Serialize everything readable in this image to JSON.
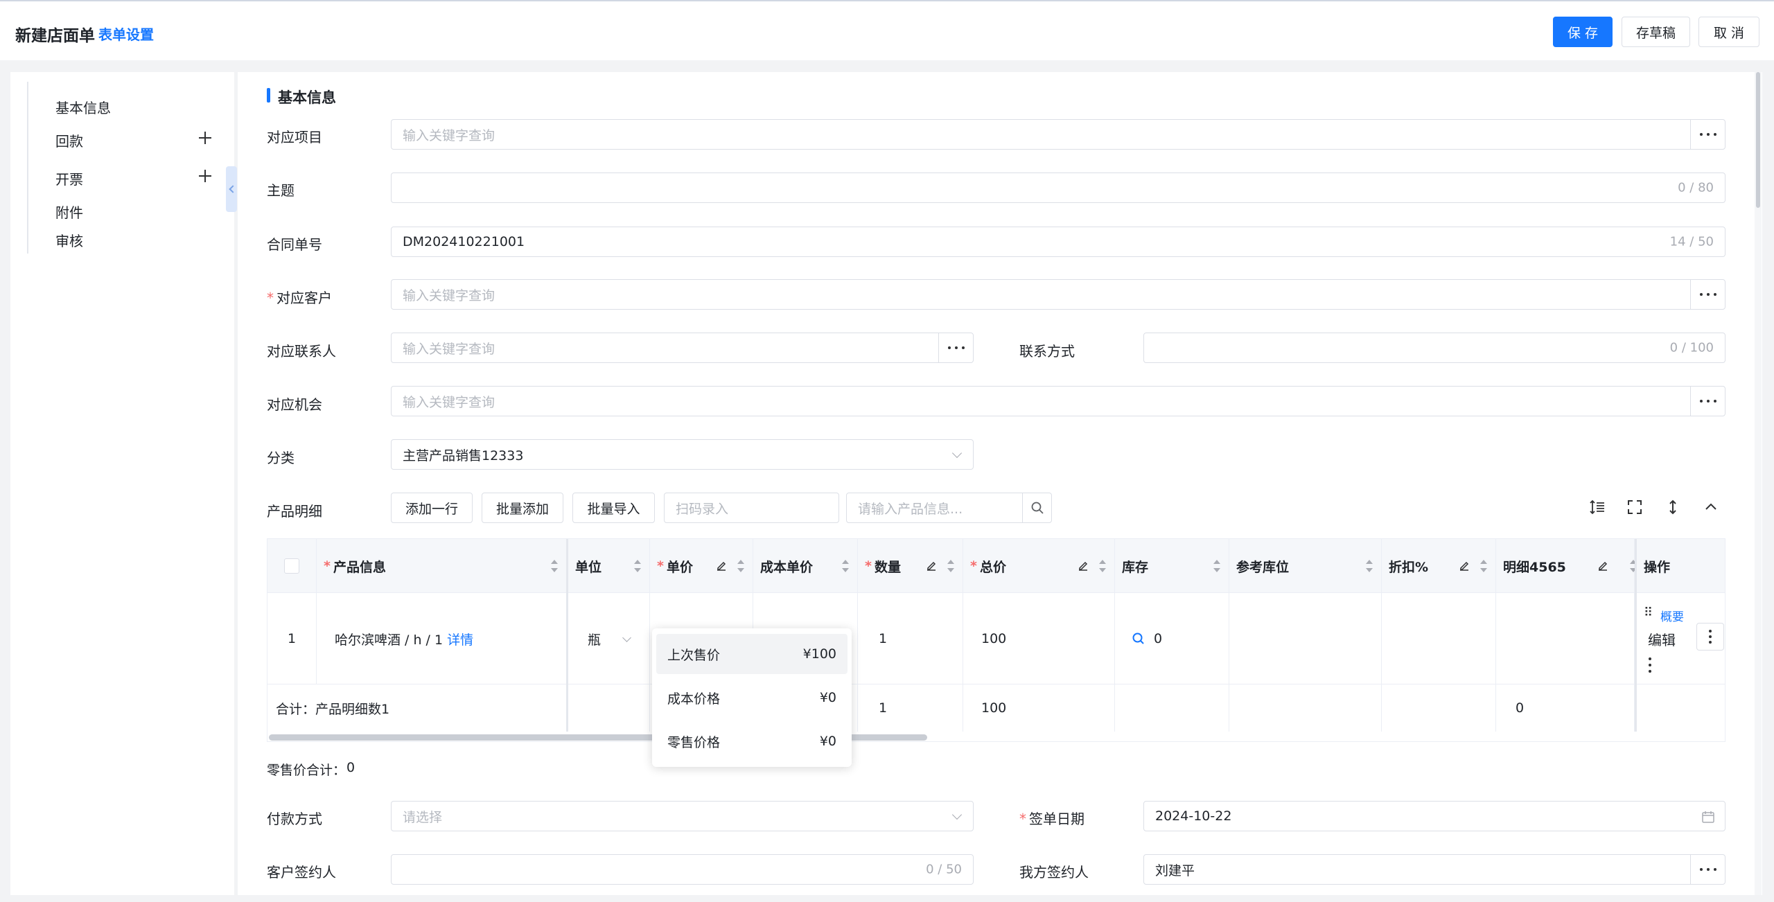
{
  "header": {
    "title": "新建店面单",
    "settings_link": "表单设置",
    "save_label": "保 存",
    "draft_label": "存草稿",
    "cancel_label": "取 消",
    "accent": "#1677ff"
  },
  "sidebar": {
    "items": [
      {
        "label": "基本信息"
      },
      {
        "label": "回款"
      },
      {
        "label": "开票"
      },
      {
        "label": "附件"
      },
      {
        "label": "审核"
      }
    ]
  },
  "section": {
    "title": "基本信息"
  },
  "form": {
    "project": {
      "label": "对应项目",
      "placeholder": "输入关键字查询"
    },
    "subject": {
      "label": "主题",
      "counter": "0 / 80"
    },
    "contract_no": {
      "label": "合同单号",
      "value": "DM202410221001",
      "counter": "14 / 50"
    },
    "customer": {
      "label": "对应客户",
      "placeholder": "输入关键字查询"
    },
    "contact": {
      "label": "对应联系人",
      "placeholder": "输入关键字查询"
    },
    "contact_method": {
      "label": "联系方式",
      "counter": "0 / 100"
    },
    "opportunity": {
      "label": "对应机会",
      "placeholder": "输入关键字查询"
    },
    "category": {
      "label": "分类",
      "value": "主营产品销售12333"
    },
    "products_label": "产品明细",
    "add_row": "添加一行",
    "batch_add": "批量添加",
    "batch_import": "批量导入",
    "scan_placeholder": "扫码录入",
    "product_search_placeholder": "请输入产品信息...",
    "retail_total_label": "零售价合计：",
    "retail_total_value": "0",
    "payment": {
      "label": "付款方式",
      "placeholder": "请选择"
    },
    "sign_date": {
      "label": "签单日期",
      "value": "2024-10-22"
    },
    "customer_signer": {
      "label": "客户签约人",
      "counter": "0 / 50"
    },
    "our_signer": {
      "label": "我方签约人",
      "value": "刘建平"
    }
  },
  "table": {
    "headers": {
      "product": "产品信息",
      "unit": "单位",
      "price": "单价",
      "cost": "成本单价",
      "qty": "数量",
      "total": "总价",
      "stock": "库存",
      "location": "参考库位",
      "discount": "折扣%",
      "detail": "明细4565",
      "ops": "操作"
    },
    "row": {
      "index": "1",
      "product_name": "哈尔滨啤酒 / h / 1",
      "detail_link": "详情",
      "unit": "瓶",
      "qty": "1",
      "total": "100",
      "stock": "0",
      "overview": "概要",
      "edit": "编辑"
    },
    "summary": {
      "label": "合计：产品明细数1",
      "qty": "1",
      "total": "100",
      "detail": "0"
    }
  },
  "price_popup": {
    "items": [
      {
        "label": "上次售价",
        "value": "¥100"
      },
      {
        "label": "成本价格",
        "value": "¥0"
      },
      {
        "label": "零售价格",
        "value": "¥0"
      }
    ]
  }
}
